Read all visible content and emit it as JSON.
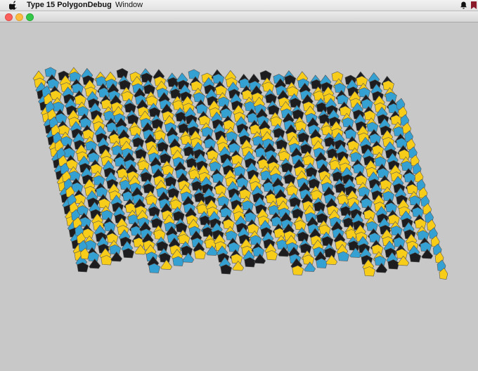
{
  "menubar": {
    "apple_icon": "apple-icon",
    "app_name": "Type 15 PolygonDebug",
    "menus": [
      "Window"
    ],
    "status_icons": [
      "bell-icon",
      "flag-icon"
    ]
  },
  "window": {
    "title": "",
    "controls": [
      "close-button",
      "minimize-button",
      "zoom-button"
    ]
  },
  "tiling": {
    "description_colors": {
      "yellow": "#f7cd1a",
      "blue": "#35a1d2",
      "black": "#1d1d1f",
      "stroke": "#555555",
      "background": "#c8c8c8"
    },
    "color_cycle": [
      "yellow",
      "yellow",
      "blue",
      "black",
      "blue",
      "black"
    ],
    "strips": 5
  }
}
